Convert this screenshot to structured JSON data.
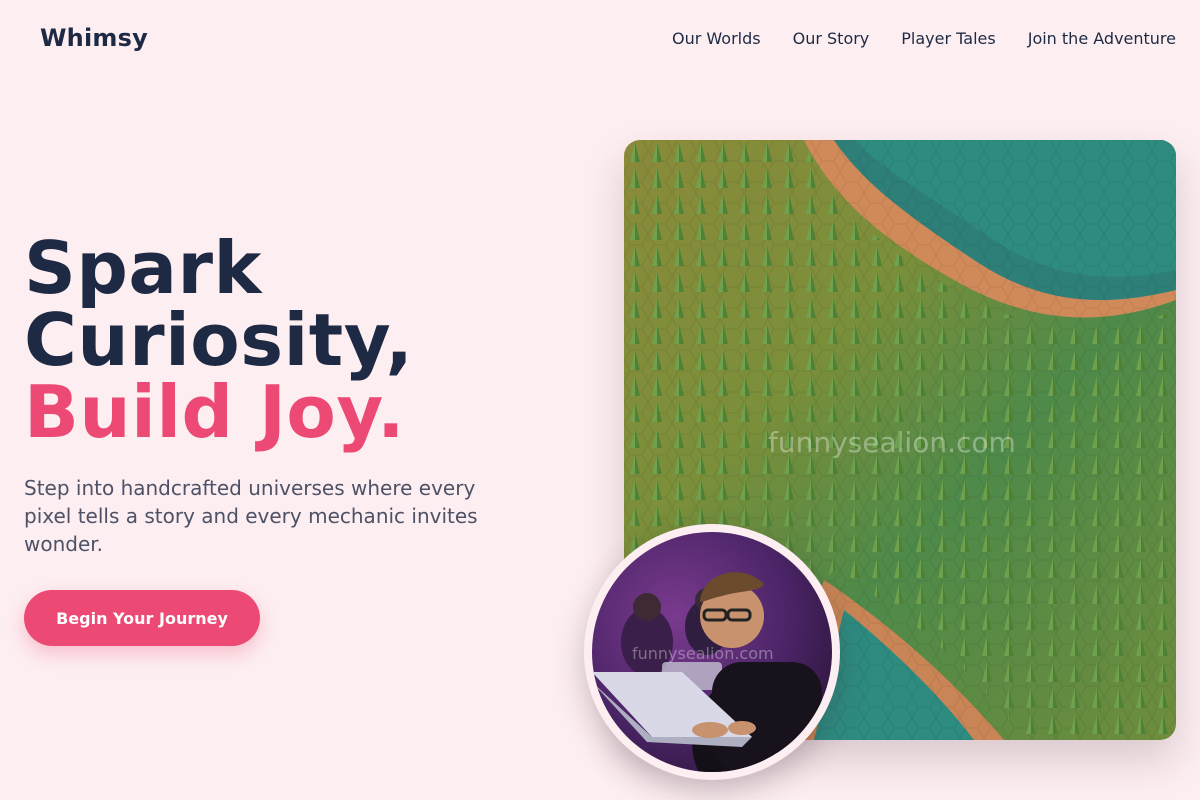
{
  "brand": {
    "name": "Whimsy"
  },
  "nav": {
    "items": [
      {
        "label": "Our Worlds"
      },
      {
        "label": "Our Story"
      },
      {
        "label": "Player Tales"
      },
      {
        "label": "Join the Adventure"
      }
    ]
  },
  "hero": {
    "title_line1": "Spark",
    "title_line2": "Curiosity,",
    "title_line3": "Build Joy.",
    "subtitle": "Step into handcrafted universes where every pixel tells a story and every mechanic invites wonder.",
    "cta_label": "Begin Your Journey",
    "watermark": "funnysealion.com"
  },
  "colors": {
    "background": "#fdeef1",
    "primary_text": "#1e2a44",
    "accent": "#ec4a74",
    "muted_text": "#4d5266"
  },
  "icons": {
    "hero_image": "hex-forest-world-image",
    "avatar": "player-at-laptop-photo"
  }
}
